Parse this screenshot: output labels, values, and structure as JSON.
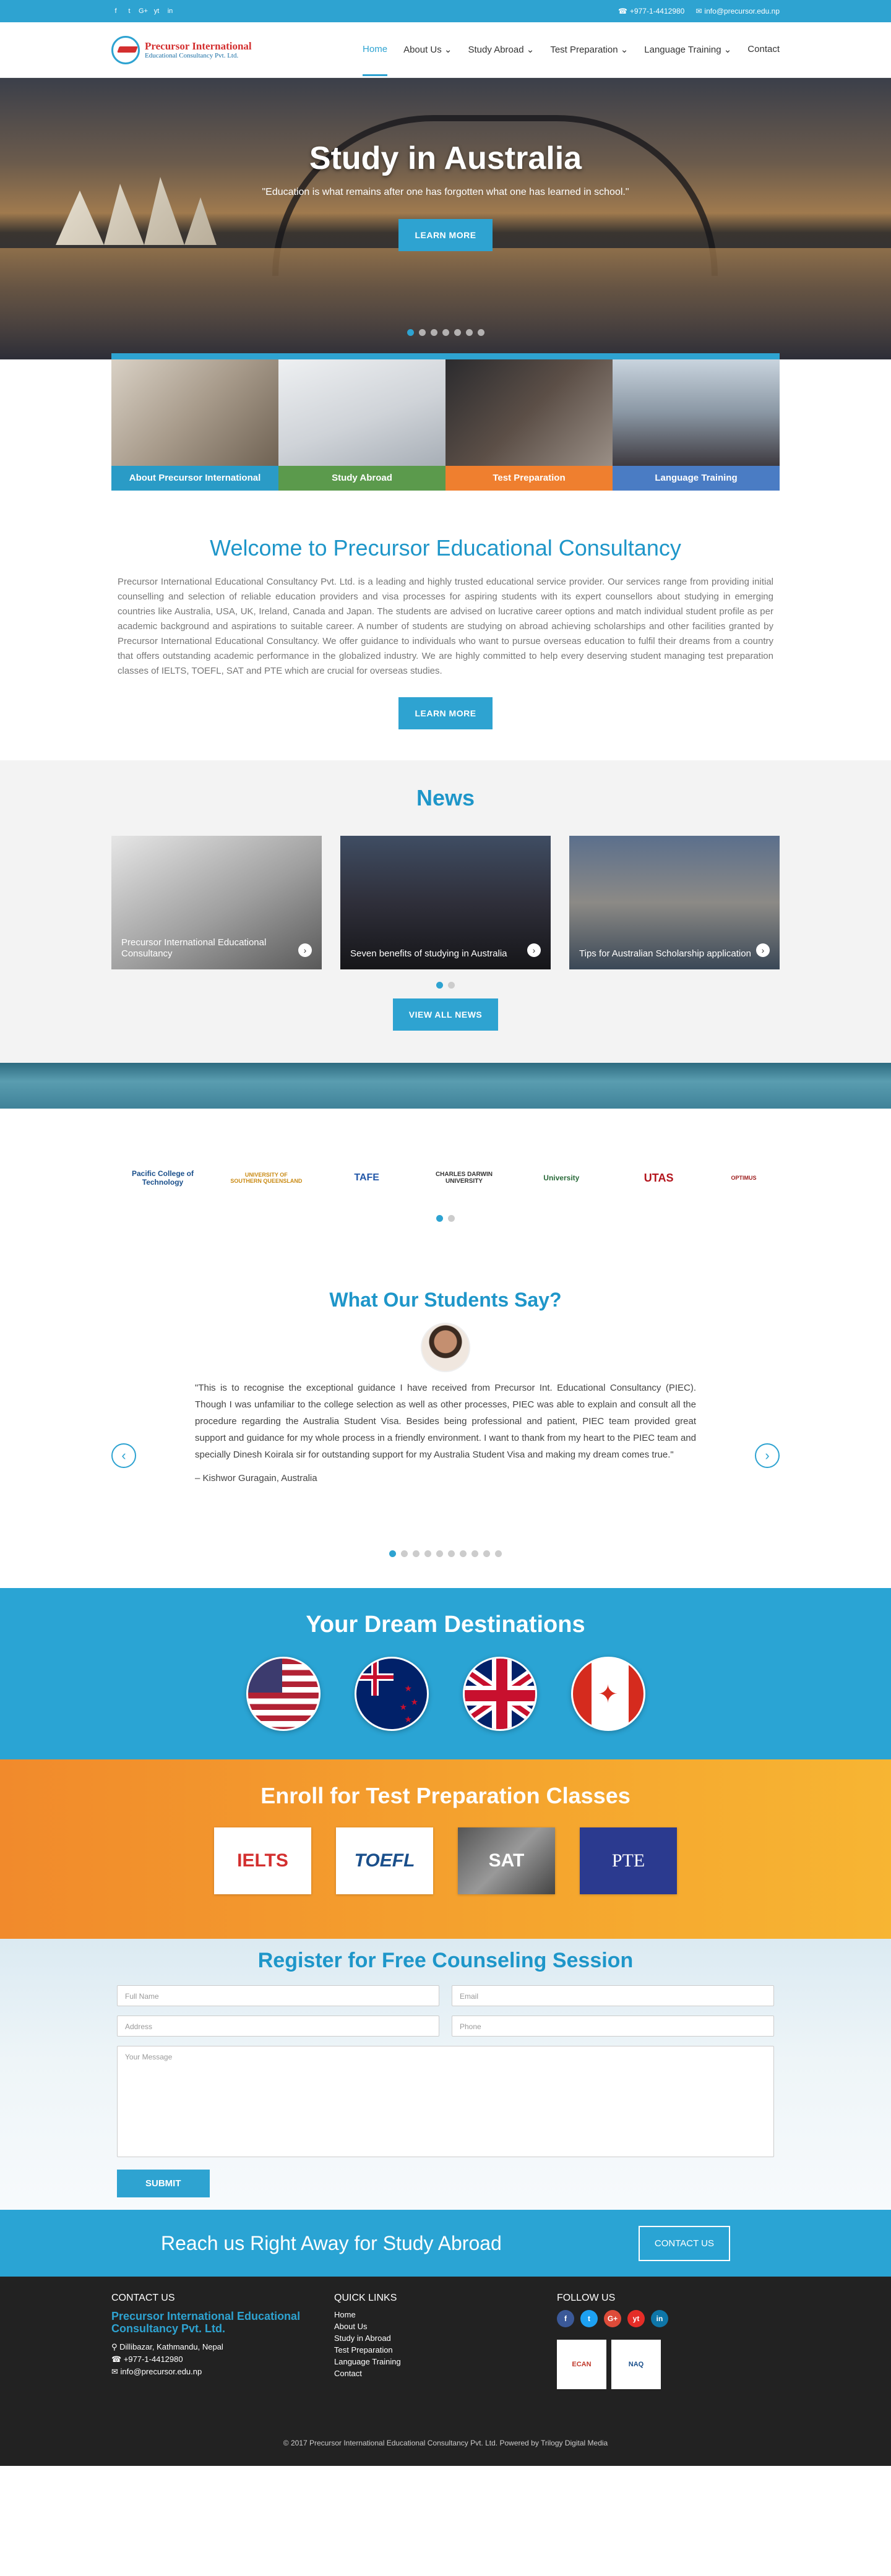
{
  "topbar": {
    "phone": "+977-1-4412980",
    "email": "info@precursor.edu.np",
    "social": [
      "f",
      "t",
      "G+",
      "yt",
      "in"
    ]
  },
  "logo": {
    "line1": "Precursor International",
    "line2": "Educational Consultancy Pvt. Ltd."
  },
  "nav": [
    {
      "label": "Home",
      "active": true
    },
    {
      "label": "About Us ⌄"
    },
    {
      "label": "Study Abroad ⌄"
    },
    {
      "label": "Test Preparation ⌄"
    },
    {
      "label": "Language Training ⌄"
    },
    {
      "label": "Contact"
    }
  ],
  "hero": {
    "title": "Study in Australia",
    "subtitle": "\"Education is what remains after one has forgotten what one has learned in school.\"",
    "button": "LEARN MORE",
    "slides": 7,
    "active_slide": 0
  },
  "tiles": [
    {
      "label": "About Precursor International",
      "color": "#2a9bc6"
    },
    {
      "label": "Study Abroad",
      "color": "#5b9a4c"
    },
    {
      "label": "Test Preparation",
      "color": "#ef7f2f"
    },
    {
      "label": "Language Training",
      "color": "#4a7cc4"
    }
  ],
  "welcome": {
    "title": "Welcome to Precursor Educational Consultancy",
    "body": "Precursor International Educational Consultancy Pvt. Ltd. is a leading and highly trusted educational service provider. Our services range from providing initial counselling and selection of reliable education providers and visa processes for aspiring students with its expert counsellors about studying in emerging countries like Australia, USA, UK, Ireland, Canada and Japan. The students are advised on lucrative career options and match individual student profile as per academic background and aspirations to suitable career. A number of students are studying on abroad achieving scholarships and other facilities granted by Precursor International Educational Consultancy. We offer guidance to individuals who want to pursue overseas education to fulfil their dreams from a country that offers outstanding academic performance in the globalized industry. We are highly committed to help every deserving student managing test preparation classes of IELTS, TOEFL, SAT and PTE which are crucial for overseas studies.",
    "button": "LEARN MORE"
  },
  "news": {
    "title": "News",
    "items": [
      {
        "caption": "Precursor International Educational Consultancy"
      },
      {
        "caption": "Seven benefits of studying in Australia"
      },
      {
        "caption": "Tips for Australian Scholarship application"
      }
    ],
    "button": "VIEW ALL NEWS"
  },
  "partners": [
    "Pacific College of Technology",
    "UNIVERSITY OF SOUTHERN QUEENSLAND",
    "TAFE",
    "CHARLES DARWIN UNIVERSITY",
    "University",
    "UTAS",
    "OPTIMUS"
  ],
  "testimonials": {
    "title": "What Our Students Say?",
    "quote": "\"This is to recognise the exceptional guidance I have received from Precursor Int. Educational Consultancy (PIEC). Though I was unfamiliar to the college selection as well as other processes, PIEC was able to explain and consult all the procedure regarding the Australia Student Visa. Besides being professional and patient, PIEC team provided great support and guidance for my whole process in a friendly environment. I want to thank from my heart to the PIEC team and specially Dinesh Koirala sir for outstanding support for my Australia Student Visa and making my dream comes true.\"",
    "author": "– Kishwor Guragain, Australia",
    "slides": 10
  },
  "destinations": {
    "title": "Your Dream Destinations",
    "countries": [
      "USA",
      "New Zealand",
      "United Kingdom",
      "Canada"
    ]
  },
  "prep": {
    "title": "Enroll for Test Preparation Classes",
    "tests": [
      "IELTS",
      "TOEFL",
      "SAT",
      "PTE"
    ]
  },
  "register": {
    "title": "Register for Free Counseling Session",
    "fields": {
      "name": "Full Name",
      "email": "Email",
      "address": "Address",
      "phone": "Phone",
      "message": "Your Message"
    },
    "submit": "SUBMIT"
  },
  "reach": {
    "text": "Reach us Right Away for Study Abroad",
    "button": "CONTACT US"
  },
  "footer": {
    "contact_title": "CONTACT US",
    "company": "Precursor International Educational Consultancy Pvt. Ltd.",
    "address": "Dillibazar, Kathmandu, Nepal",
    "phone": "+977-1-4412980",
    "email": "info@precursor.edu.np",
    "links_title": "QUICK LINKS",
    "links": [
      "Home",
      "About Us",
      "Study in Abroad",
      "Test Preparation",
      "Language Training",
      "Contact"
    ],
    "follow_title": "FOLLOW US",
    "affiliations": [
      "ECAN",
      "NAQ"
    ],
    "copyright": "© 2017 Precursor International Educational Consultancy Pvt. Ltd. Powered by Trilogy Digital Media"
  }
}
